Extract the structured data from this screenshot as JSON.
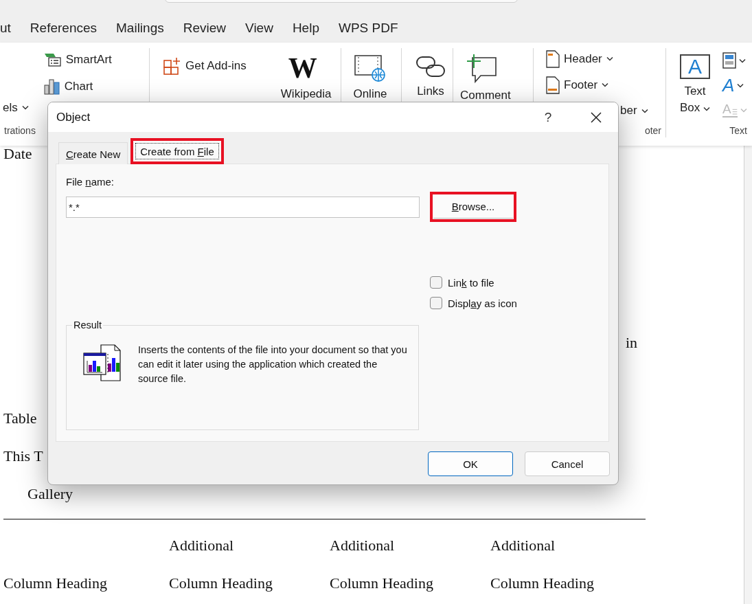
{
  "menu_tabs": [
    "ut",
    "References",
    "Mailings",
    "Review",
    "View",
    "Help",
    "WPS PDF"
  ],
  "ribbon_groups": [
    {
      "label": "trations",
      "columns": [
        [
          {
            "kind": "small",
            "label": "els",
            "dropdown": true
          }
        ],
        [
          {
            "kind": "small",
            "label": "SmartArt",
            "dropdown": false
          },
          {
            "kind": "small",
            "label": "Chart",
            "dropdown": false
          }
        ]
      ]
    },
    {
      "columns": [
        [
          {
            "kind": "small",
            "label": "Get Add-ins",
            "dropdown": false
          }
        ],
        [
          {
            "kind": "large",
            "label": "Wikipedia",
            "glyph": "W",
            "dropdown": false
          }
        ]
      ]
    },
    {
      "columns": [
        [
          {
            "kind": "large",
            "label": "Online",
            "dropdown": false
          }
        ]
      ]
    },
    {
      "columns": [
        [
          {
            "kind": "large",
            "label": "Links",
            "dropdown": false
          }
        ]
      ]
    },
    {
      "columns": [
        [
          {
            "kind": "large",
            "label": "Comment",
            "dropdown": false
          }
        ]
      ]
    },
    {
      "label": "oter",
      "columns": [
        [
          {
            "kind": "small",
            "label": "Header",
            "dropdown": true
          },
          {
            "kind": "small",
            "label": "Footer",
            "dropdown": true
          },
          {
            "kind": "small",
            "label": "ber",
            "dropdown": true
          }
        ]
      ]
    },
    {
      "label": "Text",
      "columns": [
        [
          {
            "kind": "large",
            "label": "Text Box",
            "glyph": "A",
            "dropdown": true
          }
        ],
        [
          {
            "kind": "icon",
            "dropdown": true,
            "disabled": false
          },
          {
            "kind": "icon",
            "glyph": "A",
            "dropdown": true,
            "disabled": false
          },
          {
            "kind": "icon",
            "glyph": "A",
            "dropdown": true,
            "disabled": true
          }
        ]
      ]
    }
  ],
  "document": {
    "lines": [
      {
        "kind": "left",
        "text": "Date"
      },
      {
        "kind": "right",
        "text": "in"
      },
      {
        "kind": "left",
        "text": "Table"
      },
      {
        "kind": "left",
        "text": "This T"
      },
      {
        "kind": "indent",
        "text": "Gallery"
      }
    ],
    "table_columns": [
      {
        "lines": [
          "Column Heading"
        ]
      },
      {
        "lines": [
          "Additional",
          "Column Heading"
        ]
      },
      {
        "lines": [
          "Additional",
          "Column Heading"
        ]
      },
      {
        "lines": [
          "Additional",
          "Column Heading"
        ]
      }
    ]
  },
  "dialog": {
    "title": "Object",
    "help_button": "?",
    "tabs": [
      {
        "label": {
          "key": "C",
          "after": "reate New"
        },
        "selected": false,
        "highlighted": false
      },
      {
        "label": {
          "before": "Create from ",
          "key": "F",
          "after": "ile"
        },
        "selected": true,
        "highlighted": true
      }
    ],
    "file_name_label": {
      "before": "File ",
      "key": "n",
      "after": "ame:"
    },
    "file_name_value": "*.*",
    "browse_button": {
      "label": {
        "key": "B",
        "after": "rowse..."
      },
      "highlighted": true
    },
    "options": [
      {
        "label": {
          "before": "Lin",
          "key": "k",
          "after": " to file"
        },
        "checked": false
      },
      {
        "label": {
          "before": "Displ",
          "key": "a",
          "after": "y as icon"
        },
        "checked": false
      }
    ],
    "result": {
      "label": "Result",
      "text": "Inserts the contents of the file into your document so that you can edit it later using the application which created the source file."
    },
    "buttons": [
      {
        "label": "OK",
        "default": true
      },
      {
        "label": "Cancel",
        "default": false
      }
    ]
  }
}
